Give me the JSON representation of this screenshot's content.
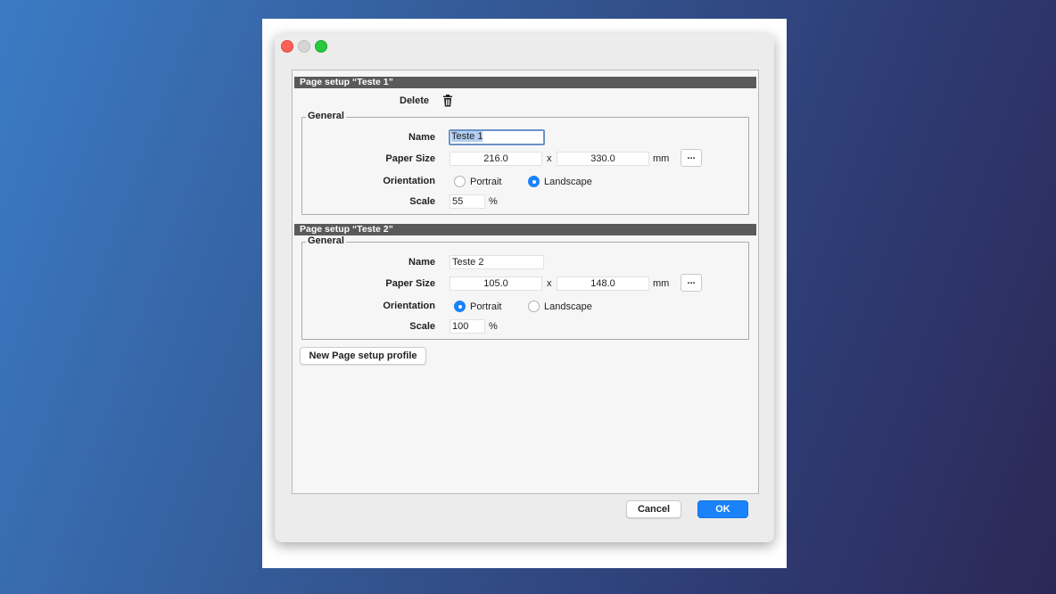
{
  "dialog": {
    "delete_label": "Delete",
    "new_profile_label": "New Page setup profile",
    "cancel_label": "Cancel",
    "ok_label": "OK"
  },
  "setups": [
    {
      "header": "Page setup “Teste 1”",
      "group_label": "General",
      "name_label": "Name",
      "name_value": "Teste 1",
      "paper_size_label": "Paper Size",
      "width": "216.0",
      "times": "x",
      "height": "330.0",
      "unit": "mm",
      "more_label": "...",
      "orientation_label": "Orientation",
      "portrait_label": "Portrait",
      "landscape_label": "Landscape",
      "orientation_selected": "Landscape",
      "scale_label": "Scale",
      "scale_value": "55",
      "percent": "%"
    },
    {
      "header": "Page setup “Teste 2”",
      "group_label": "General",
      "name_label": "Name",
      "name_value": "Teste 2",
      "paper_size_label": "Paper Size",
      "width": "105.0",
      "times": "x",
      "height": "148.0",
      "unit": "mm",
      "more_label": "...",
      "orientation_label": "Orientation",
      "portrait_label": "Portrait",
      "landscape_label": "Landscape",
      "orientation_selected": "Portrait",
      "scale_label": "Scale",
      "scale_value": "100",
      "percent": "%"
    }
  ],
  "icons": {
    "delete": "trash-icon"
  },
  "colors": {
    "accent": "#1a82fb",
    "header_bar": "#5a5a5a",
    "close": "#fe5f57",
    "maximize": "#28c840"
  }
}
